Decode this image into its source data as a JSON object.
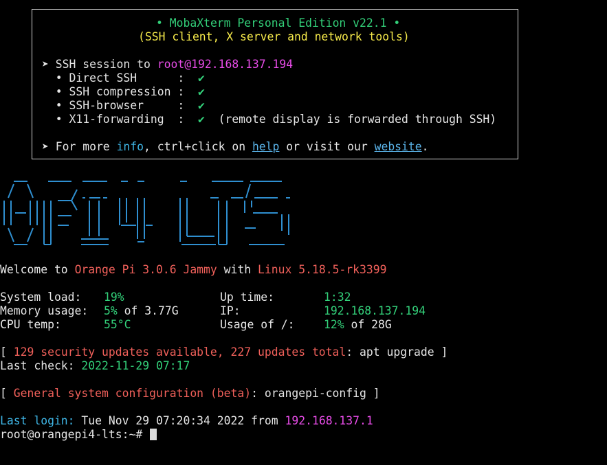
{
  "banner": {
    "title": "• MobaXterm Personal Edition v22.1 •",
    "subtitle": "(SSH client, X server and network tools)",
    "ssh_prefix": "➤ SSH session to ",
    "ssh_target": "root@192.168.137.194",
    "features": [
      {
        "label": "  • Direct SSH      :  ",
        "check": "✔",
        "note": ""
      },
      {
        "label": "  • SSH compression :  ",
        "check": "✔",
        "note": ""
      },
      {
        "label": "  • SSH-browser     :  ",
        "check": "✔",
        "note": ""
      },
      {
        "label": "  • X11-forwarding  :  ",
        "check": "✔",
        "note": "  (remote display is forwarded through SSH)"
      }
    ],
    "more_prefix": "➤ For more ",
    "more_info": "info",
    "more_mid": ", ctrl+click on ",
    "more_help": "help",
    "more_mid2": " or visit our ",
    "more_website": "website",
    "more_end": "."
  },
  "logo": {
    "alt_lines": [
      "  ___  ____ ___  _ _    _   _____ ___ ",
      " / _ \\|  _ \\_ _|| || |  | | |_   _/ __|",
      "| | | | |_) | | | || |_ | |   | | \\__ \\",
      "| |_| |  __/| | |__   _|| |___| |  ___) |",
      " \\___/|_|  |___|   |_|  |_____|_| |____/"
    ]
  },
  "welcome": {
    "prefix": "Welcome to ",
    "distro": "Orange Pi 3.0.6 Jammy",
    "mid": " with ",
    "kernel": "Linux 5.18.5-rk3399"
  },
  "stats": {
    "system_load_label": "System load:",
    "system_load_value": "19%",
    "memory_label": "Memory usage:",
    "memory_value": "5%",
    "memory_of": " of 3.77G",
    "cpu_label": "CPU temp:",
    "cpu_value": "55°C",
    "uptime_label": "Up time:",
    "uptime_value": "1:32",
    "ip_label": "IP:",
    "ip_value": "192.168.137.194",
    "usage_label": "Usage of /:",
    "usage_value": "12%",
    "usage_of": " of 28G"
  },
  "updates": {
    "open": "[ ",
    "text": "129 security updates available, 227 updates total",
    "colon": ": apt upgrade ]",
    "last_check_label": "Last check: ",
    "last_check_value": "2022-11-29 07:17"
  },
  "config": {
    "open": "[ ",
    "text": "General system configuration (beta)",
    "rest": ": orangepi-config ]"
  },
  "login": {
    "label": "Last login:",
    "text": " Tue Nov 29 07:20:34 2022 from ",
    "ip": "192.168.137.1"
  },
  "prompt": {
    "text": "root@orangepi4-lts:~# "
  },
  "colors": {
    "green": "#33d17a",
    "yellow": "#f5e94a",
    "magenta": "#e84ce8",
    "cyan": "#3fb6e6",
    "red": "#f0605a"
  }
}
